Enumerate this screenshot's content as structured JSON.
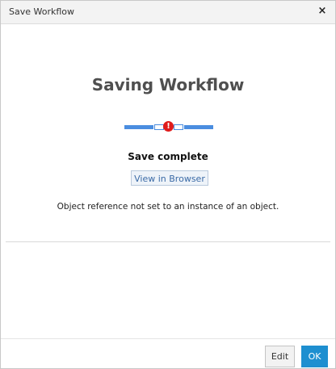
{
  "window": {
    "title": "Save Workflow",
    "close_label": "×"
  },
  "main": {
    "heading": "Saving Workflow",
    "status": "Save complete",
    "view_button": "View in Browser",
    "error_message": "Object reference not set to an instance of an object.",
    "error_icon_glyph": "!"
  },
  "footer": {
    "edit_label": "Edit",
    "ok_label": "OK"
  },
  "colors": {
    "accent": "#4a8de0",
    "error": "#e01b1b",
    "ok_button": "#1e8fd0"
  }
}
